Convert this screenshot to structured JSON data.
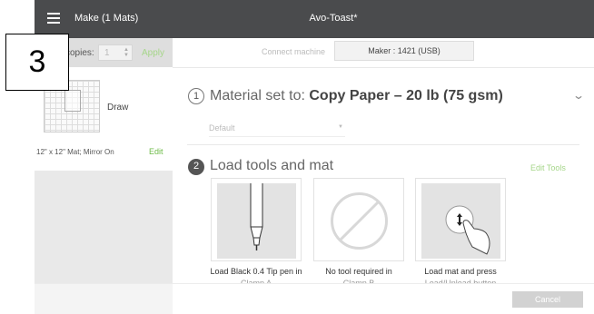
{
  "header": {
    "menu_icon": "hamburger-menu-icon",
    "make_title": "Make (1 Mats)",
    "project_title": "Avo-Toast*"
  },
  "step_number": "3",
  "left_panel": {
    "copies_label": "copies:",
    "copies_value": "1",
    "apply_label": "Apply",
    "mat": {
      "operation_label": "Draw",
      "info": "12\" x 12\" Mat; Mirror On",
      "edit_label": "Edit"
    }
  },
  "machine": {
    "connect_label": "Connect machine",
    "machine_name": "Maker : 1421 (USB)"
  },
  "step1": {
    "number": "1",
    "title_prefix": "Material set to: ",
    "material": "Copy Paper – 20 lb (75 gsm)",
    "preset": "Default"
  },
  "step2": {
    "number": "2",
    "title": "Load tools and mat",
    "edit_tools_label": "Edit Tools",
    "tools": [
      {
        "caption": "Load Black 0.4 Tip pen in",
        "caption_cut": "Clamp A"
      },
      {
        "caption": "No tool required in",
        "caption_cut": "Clamp B"
      },
      {
        "caption": "Load mat and press",
        "caption_cut": "Load/Unload button"
      }
    ]
  },
  "footer": {
    "cancel_label": "Cancel"
  },
  "colors": {
    "topbar": "#4a4b4d",
    "accent_green": "#6dbb47",
    "disabled_green": "#a6d68a",
    "panel_bg": "#e9e9e9"
  }
}
